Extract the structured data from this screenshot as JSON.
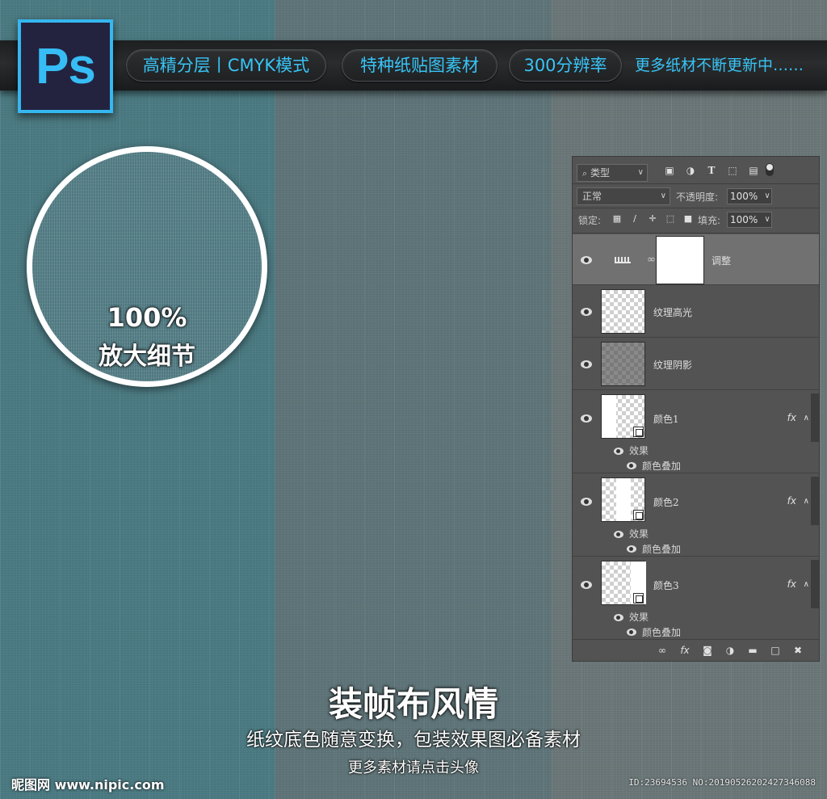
{
  "banner": {
    "logo_text": "Ps",
    "pills": [
      "高精分层丨CMYK模式",
      "特种纸贴图素材",
      "300分辨率"
    ],
    "more_text": "更多纸材不断更新中……"
  },
  "magnifier": {
    "percent": "100%",
    "label": "放大细节"
  },
  "layers_panel": {
    "filter_kind": "类型",
    "blend_mode": "正常",
    "opacity_label": "不透明度:",
    "opacity_value": "100%",
    "lock_label": "锁定:",
    "fill_label": "填充:",
    "fill_value": "100%",
    "layers": [
      {
        "name": "调整",
        "selected": true
      },
      {
        "name": "纹理高光"
      },
      {
        "name": "纹理阴影"
      },
      {
        "name": "颜色1",
        "fx": "fx",
        "effects_label": "效果",
        "effect": "颜色叠加"
      },
      {
        "name": "颜色2",
        "fx": "fx",
        "effects_label": "效果",
        "effect": "颜色叠加"
      },
      {
        "name": "颜色3",
        "fx": "fx",
        "effects_label": "效果",
        "effect": "颜色叠加"
      }
    ]
  },
  "footer_text": {
    "title": "装帧布风情",
    "subtitle": "纸纹底色随意变换，包装效果图必备素材",
    "more": "更多素材请点击头像"
  },
  "watermark": "昵图网 www.nipic.com",
  "id_text": "ID:23694536 NO:20190526202427346088",
  "colors": {
    "accent": "#38c4f5",
    "stripe_left": "#4b7a82",
    "stripe_middle": "#5e7478",
    "stripe_right": "#6a7677",
    "panel_bg": "#535353"
  }
}
